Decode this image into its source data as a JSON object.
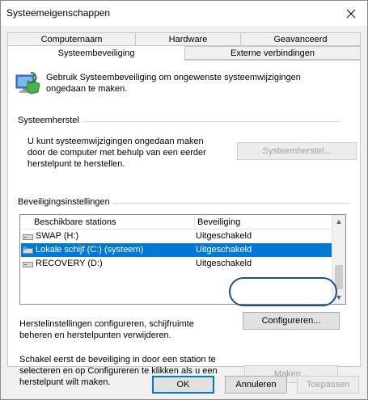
{
  "window": {
    "title": "Systeemeigenschappen"
  },
  "tabs": {
    "row1": [
      "Computernaam",
      "Hardware",
      "Geavanceerd"
    ],
    "row2": [
      "Systeembeveiliging",
      "Externe verbindingen"
    ],
    "active": "Systeembeveiliging"
  },
  "intro": {
    "text": "Gebruik Systeembeveiliging om ongewenste systeemwijzigingen ongedaan te maken."
  },
  "systemrestore": {
    "heading": "Systeemherstel",
    "description": "U kunt systeemwijzigingen ongedaan maken door de computer met behulp van een eerder herstelpunt te herstellen.",
    "button_label": "Systeemherstel..."
  },
  "protection": {
    "heading": "Beveiligingsinstellingen",
    "columns": [
      "Beschikbare stations",
      "Beveiliging"
    ],
    "drives": [
      {
        "name": "SWAP (H:)",
        "status": "Uitgeschakeld",
        "selected": false
      },
      {
        "name": "Lokale schijf (C:) (systeem)",
        "status": "Uitgeschakeld",
        "selected": true
      },
      {
        "name": "RECOVERY (D:)",
        "status": "Uitgeschakeld",
        "selected": false
      }
    ],
    "configure_text": "Herstelinstellingen configureren, schijfruimte beheren en herstelpunten verwijderen.",
    "configure_button": "Configureren...",
    "create_text": "Schakel eerst de beveiliging in door een station te selecteren en op Configureren te klikken als u een herstelpunt wilt maken.",
    "create_button": "Maken..."
  },
  "footer": {
    "ok": "OK",
    "cancel": "Annuleren",
    "apply": "Toepassen"
  },
  "colors": {
    "selection": "#0078d7",
    "highlight_ring": "#1f4e8c",
    "default_button_border": "#0078d7"
  }
}
